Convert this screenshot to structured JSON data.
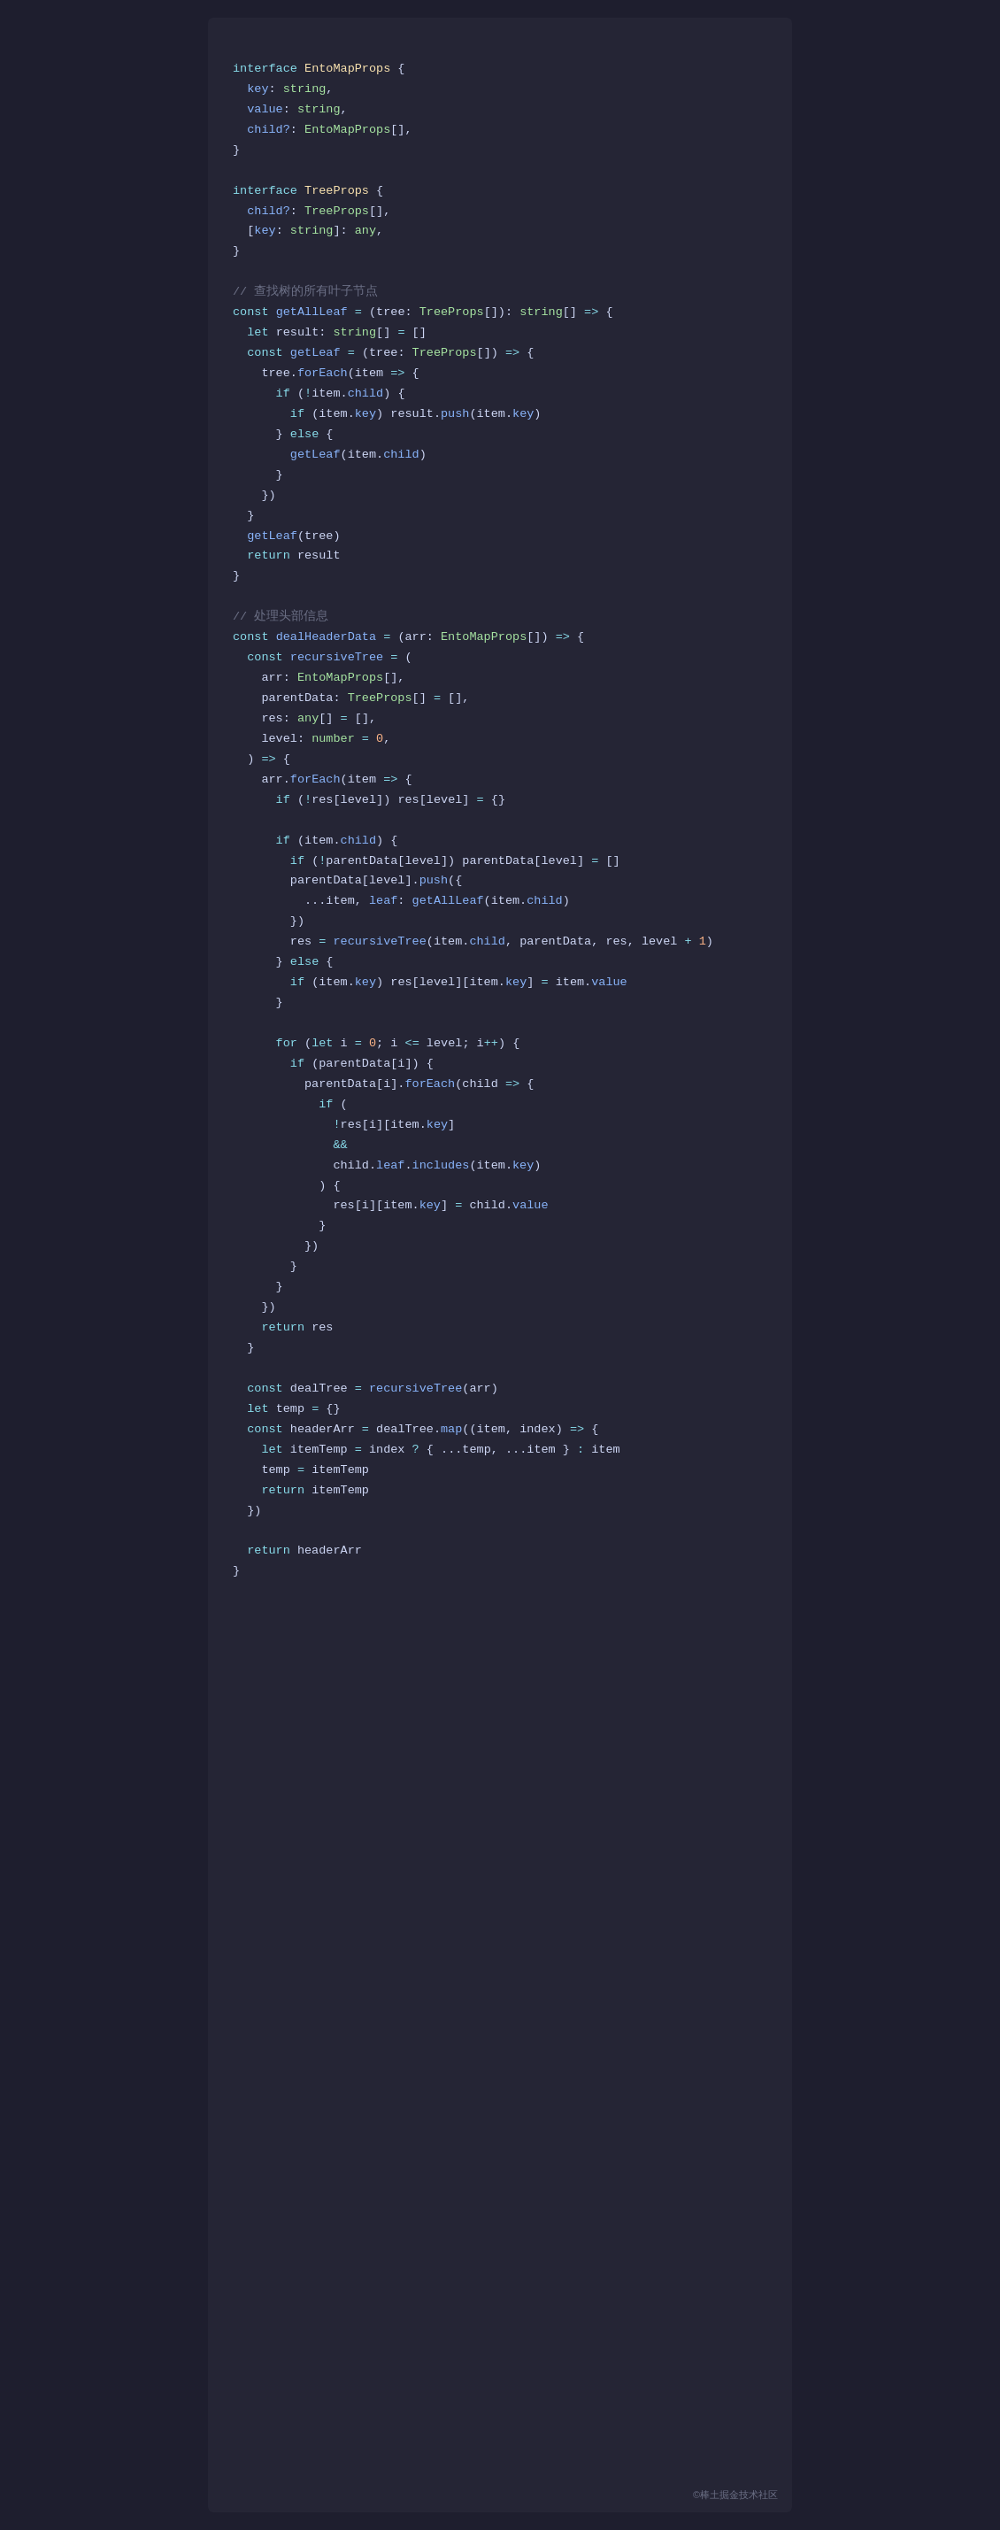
{
  "code": {
    "watermark": "©棒土掘金技术社区"
  }
}
